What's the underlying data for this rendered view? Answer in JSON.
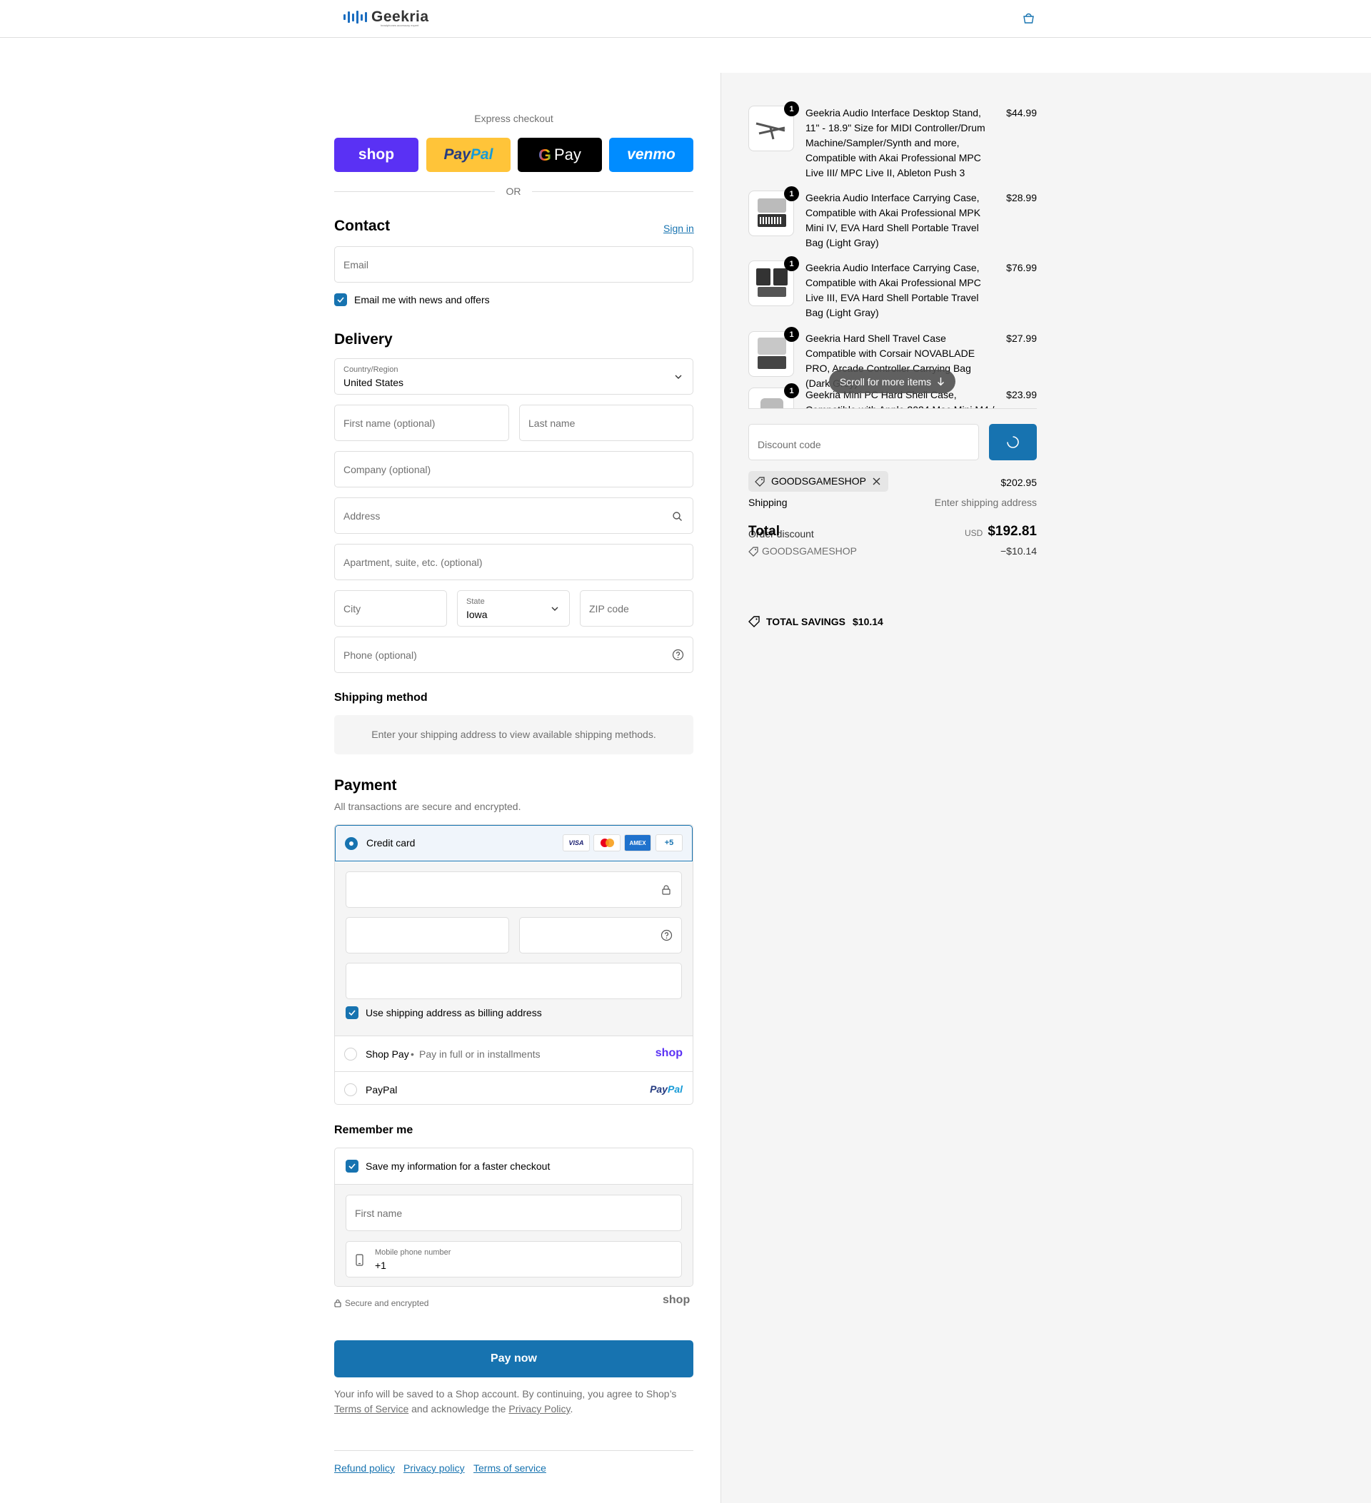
{
  "header": {
    "brand": "Geekria",
    "tagline": "headphones accessory expert",
    "bag_icon": "shopping-bag-icon"
  },
  "express": {
    "title": "Express checkout",
    "shop_label": "shop",
    "paypal_label_a": "Pay",
    "paypal_label_b": "Pal",
    "gpay_label": "Pay",
    "venmo_label": "venmo",
    "or": "OR"
  },
  "contact": {
    "heading": "Contact",
    "sign_in": "Sign in",
    "email_placeholder": "Email",
    "news_label": "Email me with news and offers"
  },
  "delivery": {
    "heading": "Delivery",
    "country_label": "Country/Region",
    "country_value": "United States",
    "first_name_placeholder": "First name (optional)",
    "last_name_placeholder": "Last name",
    "company_placeholder": "Company (optional)",
    "address_placeholder": "Address",
    "apartment_placeholder": "Apartment, suite, etc. (optional)",
    "city_placeholder": "City",
    "state_label": "State",
    "state_value": "Iowa",
    "zip_placeholder": "ZIP code",
    "phone_placeholder": "Phone (optional)"
  },
  "shipping_method": {
    "heading": "Shipping method",
    "notice": "Enter your shipping address to view available shipping methods."
  },
  "payment": {
    "heading": "Payment",
    "subtitle": "All transactions are secure and encrypted.",
    "credit_card_label": "Credit card",
    "card_logos": [
      "VISA",
      "mastercard",
      "AMEX",
      "+5"
    ],
    "billing_label": "Use shipping address as billing address",
    "shop_pay_label": "Shop Pay",
    "shop_pay_sub": "Pay in full or in installments",
    "shop_pay_logo": "shop",
    "paypal_label": "PayPal",
    "paypal_logo_a": "Pay",
    "paypal_logo_b": "Pal"
  },
  "remember": {
    "heading": "Remember me",
    "save_label": "Save my information for a faster checkout",
    "first_name_placeholder": "First name",
    "mobile_label": "Mobile phone number",
    "mobile_value": "+1",
    "secure": "Secure and encrypted",
    "shop_logo": "shop"
  },
  "pay_now": "Pay now",
  "legal": {
    "text_a": "Your info will be saved to a Shop account. By continuing, you agree to Shop’s",
    "tos": "Terms of Service",
    "text_b": "and acknowledge the",
    "privacy": "Privacy Policy",
    "period": "."
  },
  "footer_links": [
    "Refund policy",
    "Privacy policy",
    "Terms of service"
  ],
  "order": {
    "items": [
      {
        "qty": "1",
        "title": "Geekria Audio Interface Desktop Stand, 11\" - 18.9\" Size for MIDI Controller/Drum Machine/Sampler/Synth and more, Compatible with Akai Professional MPC Live III/ MPC Live II, Ableton Push 3",
        "price": "$44.99"
      },
      {
        "qty": "1",
        "title": "Geekria Audio Interface Carrying Case, Compatible with Akai Professional MPK Mini IV, EVA Hard Shell Portable Travel Bag (Light Gray)",
        "price": "$28.99"
      },
      {
        "qty": "1",
        "title": "Geekria Audio Interface Carrying Case, Compatible with Akai Professional MPC Live III, EVA Hard Shell Portable Travel Bag (Light Gray)",
        "price": "$76.99"
      },
      {
        "qty": "1",
        "title": "Geekria Hard Shell Travel Case Compatible with Corsair NOVABLADE PRO, Arcade Controller Carrying Bag (Dark Grey)",
        "price": "$27.99"
      },
      {
        "qty": "1",
        "title": "Geekria Mini PC Hard Shell Case, Compatible with Apple 2024 Mac Mini M4 /",
        "price": "$23.99"
      }
    ],
    "scroll_hint": "Scroll for more items",
    "discount_placeholder": "Discount code",
    "code": "GOODSGAMESHOP",
    "subtotal": "$202.95",
    "shipping_label": "Shipping",
    "shipping_value": "Enter shipping address",
    "order_discount_label": "Order discount",
    "discount_code": "GOODSGAMESHOP",
    "discount_value": "−$10.14",
    "total_label": "Total",
    "currency": "USD",
    "total_value": "$192.81",
    "savings_label": "TOTAL SAVINGS",
    "savings_value": "$10.14"
  },
  "colors": {
    "accent": "#1773b0",
    "shop": "#5a31f4",
    "paypal": "#ffc439",
    "venmo": "#008cff"
  }
}
